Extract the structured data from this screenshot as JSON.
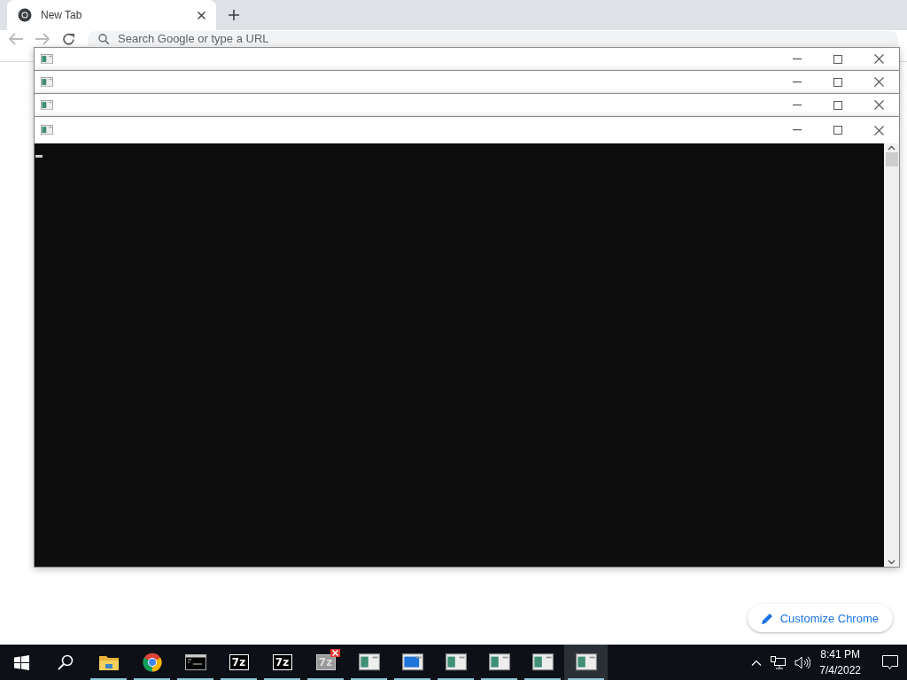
{
  "browser": {
    "tab": {
      "title": "New Tab"
    },
    "address_bar": {
      "placeholder": "Search Google or type a URL"
    },
    "customize_button": {
      "label": "Customize Chrome"
    }
  },
  "console_windows": [
    {
      "active": false
    },
    {
      "active": false
    },
    {
      "active": false
    },
    {
      "active": true
    }
  ],
  "taskbar": {
    "items": [
      {
        "kind": "start",
        "selected": false
      },
      {
        "kind": "search",
        "selected": false
      },
      {
        "kind": "folder",
        "selected": false
      },
      {
        "kind": "chrome",
        "selected": false
      },
      {
        "kind": "terminal",
        "selected": false
      },
      {
        "kind": "archive",
        "label": "7z",
        "selected": false
      },
      {
        "kind": "archive",
        "label": "7z",
        "selected": false
      },
      {
        "kind": "archive-error",
        "label": "7z",
        "selected": false
      },
      {
        "kind": "console",
        "selected": false
      },
      {
        "kind": "console-blue",
        "selected": false
      },
      {
        "kind": "console",
        "selected": false
      },
      {
        "kind": "console",
        "selected": false
      },
      {
        "kind": "console",
        "selected": false
      },
      {
        "kind": "console",
        "selected": true
      }
    ],
    "time": "8:41 PM",
    "date": "7/4/2022"
  }
}
